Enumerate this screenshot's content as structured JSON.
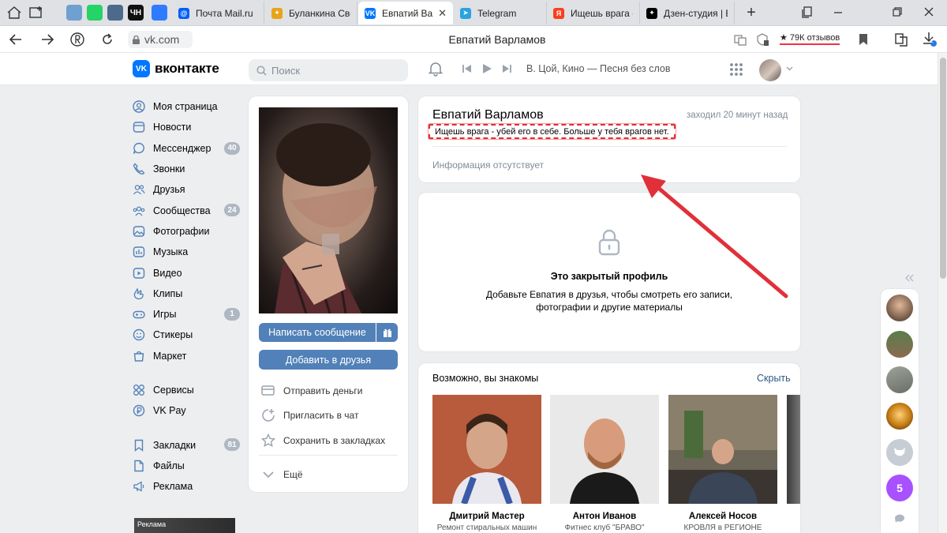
{
  "browser": {
    "pinned": [
      {
        "name": "pin-vkvideo",
        "color": "#6fa0cf",
        "label": ""
      },
      {
        "name": "pin-whatsapp",
        "color": "#25d366",
        "label": ""
      },
      {
        "name": "pin-mask",
        "color": "#4c6a8c",
        "label": ""
      },
      {
        "name": "pin-chn",
        "color": "#111111",
        "label": "ЧН"
      },
      {
        "name": "pin-cube",
        "color": "#2f7bff",
        "label": ""
      }
    ],
    "tabs": [
      {
        "title": "Почта Mail.ru",
        "color": "#005ff9",
        "icon": "@"
      },
      {
        "title": "Буланкина Све",
        "color": "#e8a317",
        "icon": "✦"
      },
      {
        "title": "Евпатий Вар",
        "color": "#0077ff",
        "icon": "VK",
        "active": true,
        "close": "✕"
      },
      {
        "title": "Telegram",
        "color": "#2aa3df",
        "icon": "➤"
      },
      {
        "title": "Ищешь врага -",
        "color": "#fc3f1d",
        "icon": "Я"
      },
      {
        "title": "Дзен-студия | Е",
        "color": "#000000",
        "icon": "✦"
      }
    ],
    "new_tab": "+",
    "url": "vk.com",
    "page_title": "Евпатий Варламов",
    "reviews": "★ 79К отзывов",
    "downloads_count": "2"
  },
  "vk": {
    "logo": "вконтакте",
    "logo_mark": "VK",
    "search_placeholder": "Поиск",
    "track": "В. Цой, Кино — Песня без слов",
    "sidebar": [
      {
        "label": "Моя страница",
        "icon": "user",
        "name": "my-page"
      },
      {
        "label": "Новости",
        "icon": "news",
        "name": "news"
      },
      {
        "label": "Мессенджер",
        "icon": "chat",
        "name": "messenger",
        "badge": "40"
      },
      {
        "label": "Звонки",
        "icon": "phone",
        "name": "calls"
      },
      {
        "label": "Друзья",
        "icon": "friends",
        "name": "friends"
      },
      {
        "label": "Сообщества",
        "icon": "groups",
        "name": "groups",
        "badge": "24"
      },
      {
        "label": "Фотографии",
        "icon": "photo",
        "name": "photos"
      },
      {
        "label": "Музыка",
        "icon": "music",
        "name": "music"
      },
      {
        "label": "Видео",
        "icon": "video",
        "name": "video"
      },
      {
        "label": "Клипы",
        "icon": "clips",
        "name": "clips"
      },
      {
        "label": "Игры",
        "icon": "games",
        "name": "games",
        "badge": "1"
      },
      {
        "label": "Стикеры",
        "icon": "stickers",
        "name": "stickers"
      },
      {
        "label": "Маркет",
        "icon": "market",
        "name": "market"
      },
      {
        "gap": true
      },
      {
        "label": "Сервисы",
        "icon": "services",
        "name": "services"
      },
      {
        "label": "VK Pay",
        "icon": "pay",
        "name": "vkpay"
      },
      {
        "gap": true
      },
      {
        "label": "Закладки",
        "icon": "bookmark",
        "name": "bookmarks",
        "badge": "81"
      },
      {
        "label": "Файлы",
        "icon": "file",
        "name": "files"
      },
      {
        "label": "Реклама",
        "icon": "ads",
        "name": "ads"
      }
    ],
    "ad_label": "Реклама",
    "profile": {
      "name": "Евпатий Варламов",
      "last_seen": "заходил 20 минут назад",
      "status": "Ищешь врага - убей его в себе. Больше у тебя врагов нет.",
      "no_info": "Информация отсутствует",
      "message_button": "Написать сообщение",
      "add_friend_button": "Добавить в друзья",
      "actions": [
        {
          "label": "Отправить деньги",
          "icon": "money"
        },
        {
          "label": "Пригласить в чат",
          "icon": "invite"
        },
        {
          "label": "Сохранить в закладках",
          "icon": "star"
        }
      ],
      "more": "Ещё",
      "closed_title": "Это закрытый профиль",
      "closed_text": "Добавьте Евпатия в друзья, чтобы смотреть его записи, фотографии и другие материалы"
    },
    "friends": {
      "title": "Возможно, вы знакомы",
      "hide": "Скрыть",
      "items": [
        {
          "name": "Дмитрий Мастер",
          "sub": "Ремонт стиральных машин",
          "bg": "#b85a3c"
        },
        {
          "name": "Антон Иванов",
          "sub": "Фитнес клуб \"БРАВО\"",
          "bg": "#e9e9e9"
        },
        {
          "name": "Алексей Носов",
          "sub": "КРОВЛЯ в РЕГИОНЕ",
          "bg": "#6b6658"
        }
      ]
    },
    "mini_badge": "5"
  },
  "colors": {
    "vk_blue": "#0077ff",
    "button": "#5181b8",
    "annotation": "#e0303a"
  }
}
